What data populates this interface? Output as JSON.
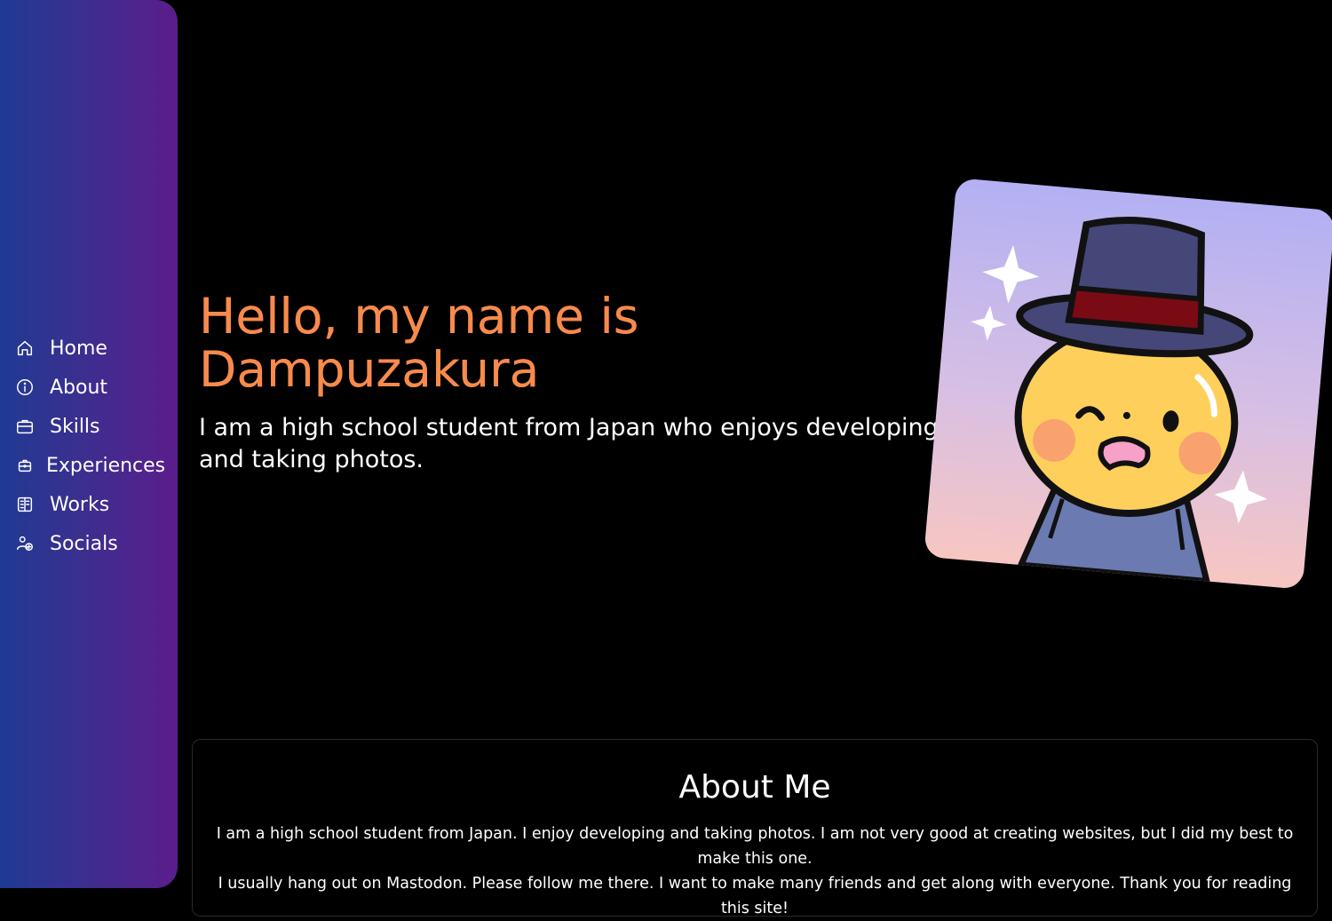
{
  "sidebar": {
    "items": [
      {
        "label": "Home",
        "icon": "home-icon"
      },
      {
        "label": "About",
        "icon": "info-icon"
      },
      {
        "label": "Skills",
        "icon": "briefcase-icon"
      },
      {
        "label": "Experiences",
        "icon": "badge-briefcase-icon"
      },
      {
        "label": "Works",
        "icon": "newspaper-icon"
      },
      {
        "label": "Socials",
        "icon": "users-plus-icon"
      }
    ]
  },
  "hero": {
    "title": "Hello, my name is Dampuzakura",
    "subtitle_line1": "I am a high school student from Japan who enjoys developing",
    "subtitle_line2": "and taking photos."
  },
  "about": {
    "title": "About Me",
    "line1": "I am a high school student from Japan. I enjoy developing and taking photos. I am not very good at creating websites, but I did my best to make this one.",
    "line2": "I usually hang out on Mastodon. Please follow me there. I want to make many friends and get along with everyone. Thank you for reading this site!"
  },
  "colors": {
    "accent_orange": "#f88a4c",
    "sidebar_start": "#1f3a93",
    "sidebar_end": "#5b1d8c",
    "background": "#000000"
  }
}
